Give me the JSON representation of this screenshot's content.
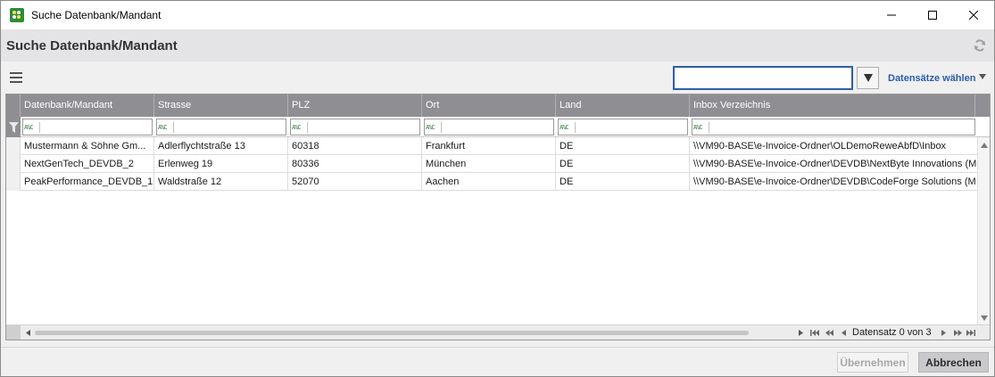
{
  "window": {
    "title": "Suche Datenbank/Mandant"
  },
  "header": {
    "title": "Suche Datenbank/Mandant"
  },
  "toolbar": {
    "search_value": "",
    "records_link": "Datensätze wählen"
  },
  "grid": {
    "columns": [
      {
        "label": "Datenbank/Mandant"
      },
      {
        "label": "Strasse"
      },
      {
        "label": "PLZ"
      },
      {
        "label": "Ort"
      },
      {
        "label": "Land"
      },
      {
        "label": "Inbox Verzeichnis"
      }
    ],
    "filter_operator": "A%C",
    "rows": [
      {
        "datenbank": "Mustermann & Söhne Gm...",
        "strasse": "Adlerflychtstraße 13",
        "plz": "60318",
        "ort": "Frankfurt",
        "land": "DE",
        "inbox": "\\\\VM90-BASE\\e-Invoice-Ordner\\OLDemoReweAbfD\\Inbox"
      },
      {
        "datenbank": "NextGenTech_DEVDB_2",
        "strasse": "Erlenweg 19",
        "plz": "80336",
        "ort": "München",
        "land": "DE",
        "inbox": "\\\\VM90-BASE\\e-Invoice-Ordner\\DEVDB\\NextByte Innovations (M"
      },
      {
        "datenbank": "PeakPerformance_DEVDB_1",
        "strasse": "Waldstraße 12",
        "plz": "52070",
        "ort": "Aachen",
        "land": "DE",
        "inbox": "\\\\VM90-BASE\\e-Invoice-Ordner\\DEVDB\\CodeForge Solutions (M"
      }
    ],
    "record_info": "Datensatz 0 von 3"
  },
  "footer": {
    "apply_label": "Übernehmen",
    "cancel_label": "Abbrechen"
  },
  "colors": {
    "accent": "#2f5fa8",
    "header_gray": "#8f8f93",
    "link_blue": "#2a5db0"
  }
}
